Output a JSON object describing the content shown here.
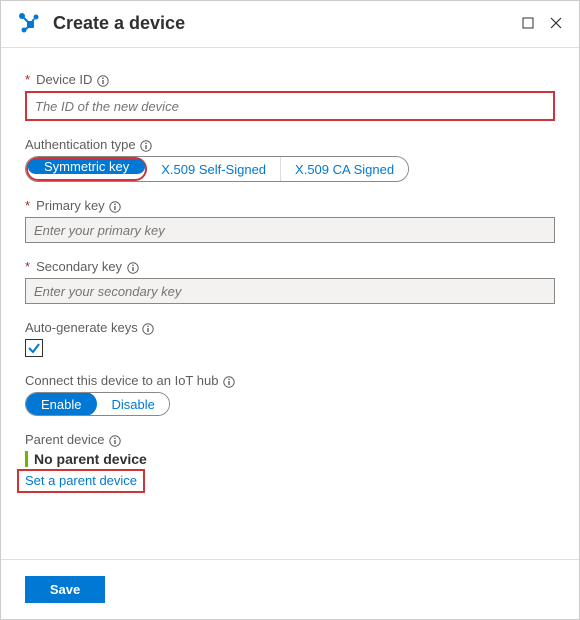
{
  "header": {
    "title": "Create a device"
  },
  "fields": {
    "device_id": {
      "label": "Device ID",
      "placeholder": "The ID of the new device"
    },
    "auth_type": {
      "label": "Authentication type",
      "options": [
        "Symmetric key",
        "X.509 Self-Signed",
        "X.509 CA Signed"
      ],
      "selected": "Symmetric key"
    },
    "primary_key": {
      "label": "Primary key",
      "placeholder": "Enter your primary key"
    },
    "secondary_key": {
      "label": "Secondary key",
      "placeholder": "Enter your secondary key"
    },
    "auto_generate": {
      "label": "Auto-generate keys",
      "checked": true
    },
    "connect_hub": {
      "label": "Connect this device to an IoT hub",
      "options": [
        "Enable",
        "Disable"
      ],
      "selected": "Enable"
    },
    "parent_device": {
      "label": "Parent device",
      "value": "No parent device",
      "action": "Set a parent device"
    }
  },
  "footer": {
    "save_label": "Save"
  }
}
